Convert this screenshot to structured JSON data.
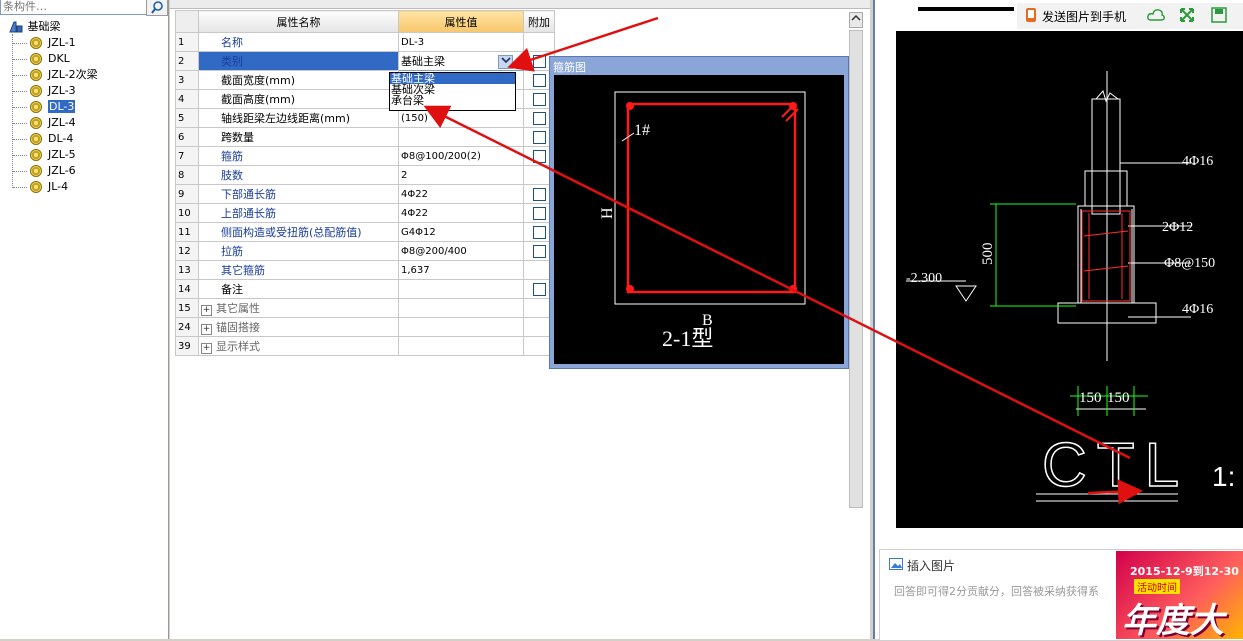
{
  "tree": {
    "search_placeholder": "条构件…",
    "root_label": "基础梁",
    "items": [
      "JZL-1",
      "DKL",
      "JZL-2次梁",
      "JZL-3",
      "DL-3",
      "JZL-4",
      "DL-4",
      "JZL-5",
      "JZL-6",
      "JL-4"
    ],
    "selected_index": 4
  },
  "grid": {
    "headers": {
      "name": "属性名称",
      "value": "属性值",
      "add": "附加"
    },
    "rows": [
      {
        "num": "1",
        "name": "名称",
        "value": "DL-3",
        "check": false
      },
      {
        "num": "2",
        "name": "类别",
        "value": "基础主梁",
        "check": true
      },
      {
        "num": "3",
        "name": "截面宽度(mm)",
        "value": "",
        "check": true
      },
      {
        "num": "4",
        "name": "截面高度(mm)",
        "value": "",
        "check": true
      },
      {
        "num": "5",
        "name": "轴线距梁左边线距离(mm)",
        "value": "(150)",
        "check": true
      },
      {
        "num": "6",
        "name": "跨数量",
        "value": "",
        "check": true
      },
      {
        "num": "7",
        "name": "箍筋",
        "value": "Φ8@100/200(2)",
        "check": true
      },
      {
        "num": "8",
        "name": "肢数",
        "value": "2",
        "check": false
      },
      {
        "num": "9",
        "name": "下部通长筋",
        "value": "4Φ22",
        "check": true
      },
      {
        "num": "10",
        "name": "上部通长筋",
        "value": "4Φ22",
        "check": true
      },
      {
        "num": "11",
        "name": "侧面构造或受扭筋(总配筋值)",
        "value": "G4Φ12",
        "check": true
      },
      {
        "num": "12",
        "name": "拉筋",
        "value": "Φ8@200/400",
        "check": true
      },
      {
        "num": "13",
        "name": "其它箍筋",
        "value": "1,637",
        "check": false
      },
      {
        "num": "14",
        "name": "备注",
        "value": "",
        "check": true
      },
      {
        "num": "15",
        "name": "其它属性",
        "value": "",
        "check": false
      },
      {
        "num": "24",
        "name": "锚固搭接",
        "value": "",
        "check": false
      },
      {
        "num": "39",
        "name": "显示样式",
        "value": "",
        "check": false
      }
    ],
    "dropdown_options": [
      "基础主梁",
      "基础次梁",
      "承台梁"
    ]
  },
  "figure": {
    "title": "箍筋图",
    "label_1": "1#",
    "label_h": "H",
    "label_b": "B",
    "type_label": "2-1型"
  },
  "viewer": {
    "send_label": "发送图片到手机",
    "cad_labels": {
      "top_bar": "4Φ16",
      "side_bar": "2Φ12",
      "stirrup": "Φ8@150",
      "bottom_bar": "4Φ16",
      "height": "500",
      "elevation": "-2.300",
      "width_1": "150",
      "width_2": "150",
      "title": "CTL",
      "scale": "1:"
    }
  },
  "answer": {
    "insert_label": "插入图片",
    "hint": "回答即可得2分贡献分，回答被采纳获得系"
  },
  "ad": {
    "date_text": "2015-12-9到12-30",
    "sub_text": "活动时间",
    "big_text": "年度大"
  },
  "colors": {
    "select_blue": "#316ac5",
    "arrow_red": "#e01010",
    "link_blue": "#1a3d9c"
  }
}
